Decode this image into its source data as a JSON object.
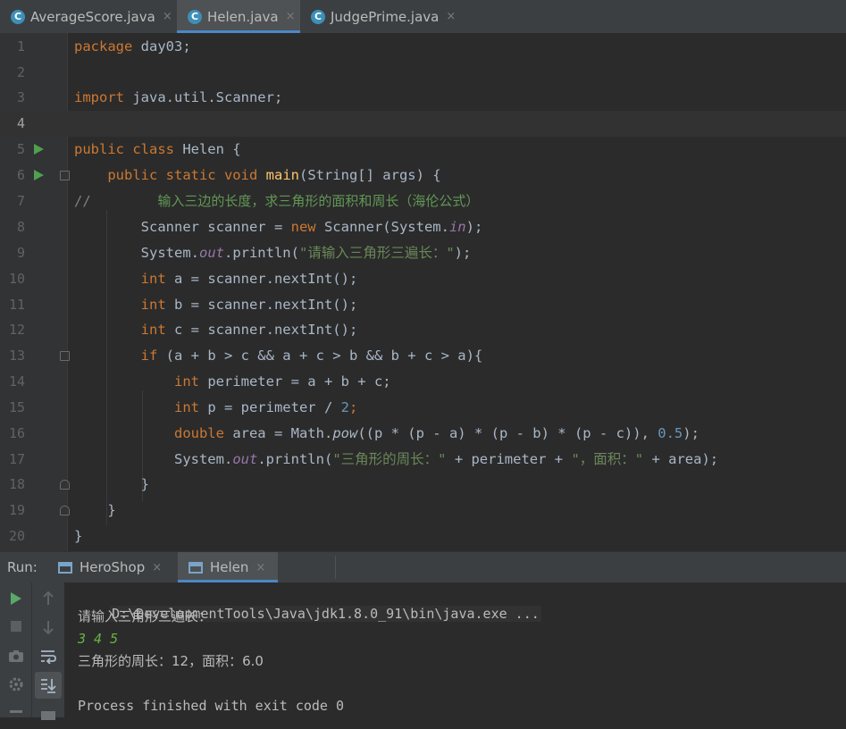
{
  "editor_tabs": [
    {
      "label": "AverageScore.java",
      "icon": "class-c-icon",
      "active": false
    },
    {
      "label": "Helen.java",
      "icon": "class-c-icon",
      "active": true
    },
    {
      "label": "JudgePrime.java",
      "icon": "class-c-icon",
      "active": false
    }
  ],
  "tab_close_glyph": "×",
  "class_icon_letter": "C",
  "code": {
    "line_numbers": [
      "1",
      "2",
      "3",
      "4",
      "5",
      "6",
      "7",
      "8",
      "9",
      "10",
      "11",
      "12",
      "13",
      "14",
      "15",
      "16",
      "17",
      "18",
      "19",
      "20"
    ],
    "l1_kw": "package",
    "l1_rest": " day03;",
    "l3_kw": "import",
    "l3_rest": " java.util.Scanner;",
    "l5_kw": "public class",
    "l5_rest": " Helen {",
    "l6_kw": "public static void",
    "l6_method": "main",
    "l6_rest": "(String[] args) {",
    "l7_comment": "//",
    "l7_text": "输入三边的长度，求三角形的面积和周长（海伦公式）",
    "l8_a": "Scanner scanner = ",
    "l8_kw": "new",
    "l8_b": " Scanner(System.",
    "l8_field": "in",
    "l8_c": ");",
    "l9_a": "System.",
    "l9_field": "out",
    "l9_b": ".println(",
    "l9_str": "\"请输入三角形三遍长：\"",
    "l9_c": ");",
    "l10_kw": "int",
    "l10_rest": " a = scanner.nextInt();",
    "l11_kw": "int",
    "l11_rest": " b = scanner.nextInt();",
    "l12_kw": "int",
    "l12_rest": " c = scanner.nextInt();",
    "l13_kw": "if",
    "l13_rest": " (a + b > c && a + c > b && b + c > a){",
    "l14_kw": "int",
    "l14_rest": " perimeter = a + b + c;",
    "l15_kw": "int",
    "l15_rest": " p = perimeter / ",
    "l15_num": "2",
    "l15_end": ";",
    "l16_kw": "double",
    "l16_a": " area = Math.",
    "l16_m": "pow",
    "l16_b": "((p * (p - a) * (p - b) * (p - c)), ",
    "l16_num": "0.5",
    "l16_c": ");",
    "l17_a": "System.",
    "l17_field": "out",
    "l17_b": ".println(",
    "l17_str1": "\"三角形的周长：\"",
    "l17_c": " + perimeter + ",
    "l17_str2": "\"，面积：\"",
    "l17_d": " + area);",
    "l18": "}",
    "l19": "}",
    "l20": "}"
  },
  "run_panel": {
    "label": "Run:",
    "tabs": [
      {
        "label": "HeroShop",
        "active": false
      },
      {
        "label": "Helen",
        "active": true
      }
    ]
  },
  "console": {
    "command": "D:\\DevelopmentTools\\Java\\jdk1.8.0_91\\bin\\java.exe ...",
    "prompt": "请输入三角形三遍长：",
    "input": "3 4 5",
    "result": "三角形的周长：12，面积：6.0",
    "exit": "Process finished with exit code 0"
  },
  "colors": {
    "keyword": "#cc7832",
    "string": "#6a8759",
    "number": "#6897bb",
    "field": "#9876aa",
    "method": "#ffc66d",
    "input": "#62b543",
    "accent": "#4a88c7"
  }
}
